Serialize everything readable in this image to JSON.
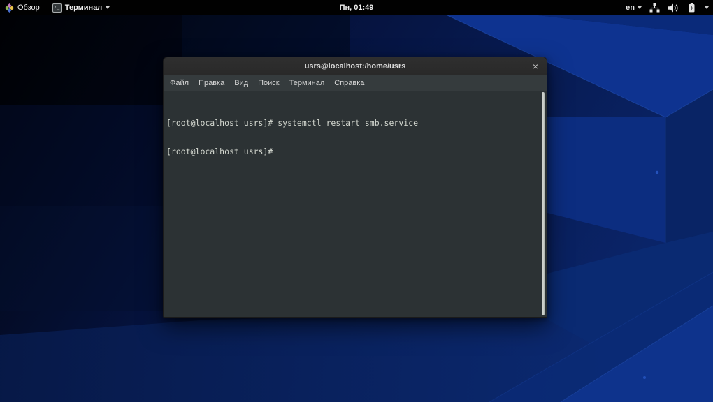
{
  "topbar": {
    "activities_label": "Обзор",
    "app_menu_label": "Терминал",
    "clock": "Пн, 01:49",
    "keyboard_layout": "en"
  },
  "window": {
    "title": "usrs@localhost:/home/usrs",
    "close_label": "×",
    "menu": [
      "Файл",
      "Правка",
      "Вид",
      "Поиск",
      "Терминал",
      "Справка"
    ]
  },
  "terminal": {
    "lines": [
      "[root@localhost usrs]# systemctl restart smb.service",
      "[root@localhost usrs]#"
    ]
  },
  "icons": {
    "distro_logo": "centos-pinwheel",
    "app_icon_glyph": "›_",
    "keyboard_dropdown": "chevron-down",
    "network": "wired-network",
    "volume": "speaker-high",
    "battery": "battery-charging",
    "system_dropdown": "chevron-down",
    "close": "window-close"
  },
  "colors": {
    "topbar_bg": "#010101",
    "titlebar_bg": "#2b2b2b",
    "menubar_bg": "#353b3d",
    "terminal_bg": "#2c3234",
    "terminal_fg": "#d3d7cf",
    "wallpaper_dark": "#01040f",
    "wallpaper_blue": "#0e3390"
  }
}
